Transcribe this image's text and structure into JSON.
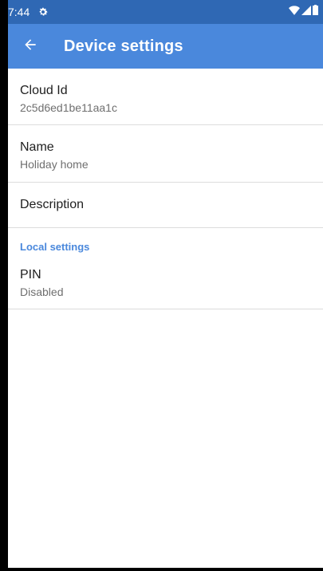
{
  "status_bar": {
    "time": "7:44",
    "icons": [
      "gear-icon",
      "wifi-icon",
      "cell-signal-icon",
      "battery-icon"
    ]
  },
  "app_bar": {
    "title": "Device settings",
    "back_icon": "arrow-back-icon"
  },
  "colors": {
    "status_bar": "#2f68b4",
    "app_bar": "#4a88dc",
    "accent": "#4a88dc"
  },
  "settings": {
    "cloud_id": {
      "title": "Cloud Id",
      "summary": "2c5d6ed1be11aa1c"
    },
    "name": {
      "title": "Name",
      "summary": "Holiday home"
    },
    "description": {
      "title": "Description"
    },
    "local_section": {
      "header": "Local settings"
    },
    "pin": {
      "title": "PIN",
      "summary": "Disabled"
    }
  }
}
